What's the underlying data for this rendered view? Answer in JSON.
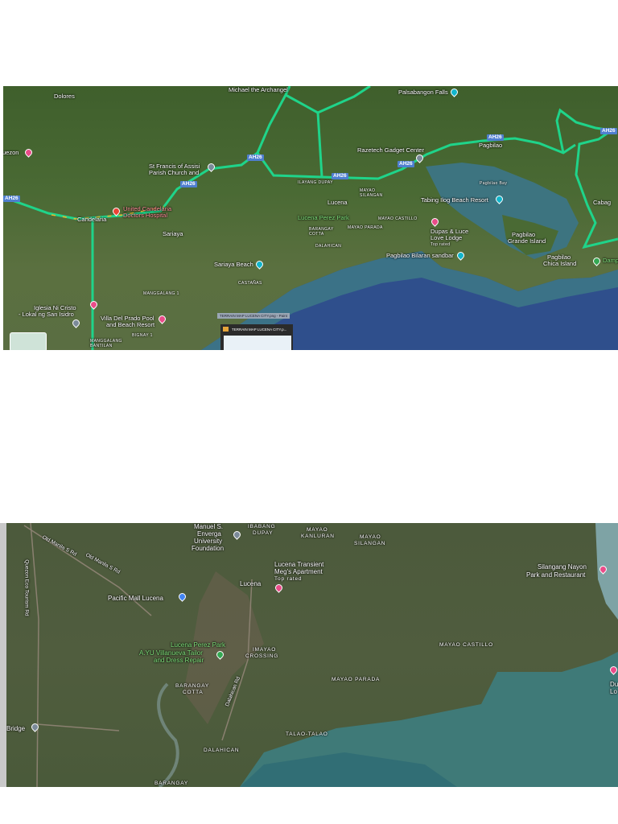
{
  "map1": {
    "labels": {
      "michael": "Michael the Archangel",
      "palsabangon": "Palsabangon Falls",
      "dolores": "Dolores",
      "quezon": "uezon",
      "razetech": "Razetech Gadget Center",
      "pagbilao": "Pagbilao",
      "st_francis_1": "St Francis of Assisi",
      "st_francis_2": "Parish Church and",
      "candelaria": "Candelaria",
      "hospital_1": "United Candelaria",
      "hospital_2": "Doctors Hospital",
      "sariaya": "Sariaya",
      "lucena": "Lucena",
      "perez_park": "Lucena Perez Park",
      "ilayang_dupay": "ILAYANG DUPAY",
      "mayao_silangan": "MAYAO SILANGAN",
      "mayao_castillo": "MAYAO CASTILLO",
      "mayao_parada": "MAYAO PARADA",
      "barangay_cotta": "BARANGAY COTTA",
      "dalahican": "DALAHICAN",
      "pagbilao_bay": "Pagbilao Bay",
      "tabing_ilog": "Tabing Ilog Beach Resort",
      "dupas_1": "Dupas & Luce",
      "dupas_2": "Love Lodge",
      "dupas_3": "Top rated",
      "bilaran": "Pagbilao Bilaran sandbar",
      "grande_1": "Pagbilao",
      "grande_2": "Grande Island",
      "chica_1": "Pagbilao",
      "chica_2": "Chica Island",
      "cabag": "Cabag",
      "damp": "Damp",
      "sariaya_beach": "Sariaya Beach",
      "castanas": "CASTAÑAS",
      "manggalang1": "MANGGALANG 1",
      "iglesia_1": "Iglesia Ni Cristo",
      "iglesia_2": "- Lokal ng San Isidro",
      "villa_1": "Villa Del Prado Pool",
      "villa_2": "and Beach Resort",
      "bignay": "BIGNAY 1",
      "manggalang_1": "MANGGALANG",
      "manggalang_2": "BANTILAN"
    },
    "shields": {
      "ah26": "AH26"
    },
    "taskbar_tooltip": "TERRAIN MAP LUCENA CITY.png - Paint",
    "taskbar_window_title": "TERRAIN MAP LUCENA CITY.p..."
  },
  "map2": {
    "labels": {
      "manuel_1": "Manuel S.",
      "manuel_2": "Enverga",
      "manuel_3": "University",
      "manuel_4": "Foundation",
      "ibabang_dupay_1": "IBABANG",
      "ibabang_dupay_2": "DUPAY",
      "mayao_kanluran_1": "MAYAO",
      "mayao_kanluran_2": "KANLURAN",
      "mayao_silangan_1": "MAYAO",
      "mayao_silangan_2": "SILANGAN",
      "old_manila_1": "Old Manila S Rd",
      "old_manila_2": "Old Manila S Rd",
      "quezon_eco": "Quezon Eco Tourism Rd",
      "transient_1": "Lucena Transient",
      "transient_2": "Meg's Apartment",
      "transient_3": "Top rated",
      "lucena": "Lucena",
      "pacific_mall": "Pacific Mall Lucena",
      "silangang_1": "Silangang Nayon",
      "silangang_2": "Park and Restaurant",
      "perez_park": "Lucena Perez Park",
      "ayu_1": "A.YU Villanueva Tailor",
      "ayu_2": "and Dress Repair",
      "imayao_1": "IMAYAO",
      "imayao_2": "CROSSING",
      "mayao_castillo": "MAYAO CASTILLO",
      "cotta_1": "BARANGAY",
      "cotta_2": "COTTA",
      "dalahican_rd": "Dalahican Rd",
      "mayao_parada": "MAYAO PARADA",
      "du_1": "Du",
      "du_2": "Lo",
      "bridge": "Bridge",
      "talao": "TALAO-TALAO",
      "dalahican": "DALAHICAN",
      "barangay_bottom": "BARANGAY"
    }
  }
}
